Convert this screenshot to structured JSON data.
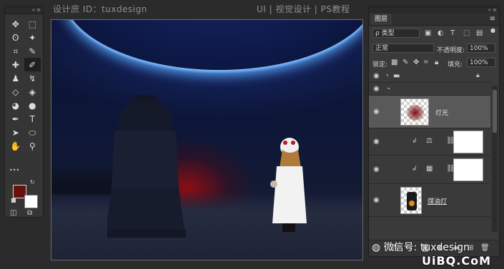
{
  "header": {
    "left_text": "设计庶 ID：tuxdesign",
    "right_text": "UI | 视觉设计 | PS教程"
  },
  "toolbar": {
    "collapse": "« ≡",
    "tools": [
      {
        "name": "move-tool",
        "glyph": "✥"
      },
      {
        "name": "marquee-tool",
        "glyph": "⬚"
      },
      {
        "name": "lasso-tool",
        "glyph": "ʘ"
      },
      {
        "name": "magic-wand-tool",
        "glyph": "✦"
      },
      {
        "name": "crop-tool",
        "glyph": "⌗"
      },
      {
        "name": "eyedropper-tool",
        "glyph": "✎"
      },
      {
        "name": "healing-tool",
        "glyph": "✚"
      },
      {
        "name": "brush-tool",
        "glyph": "✐"
      },
      {
        "name": "stamp-tool",
        "glyph": "♟"
      },
      {
        "name": "history-brush-tool",
        "glyph": "↯"
      },
      {
        "name": "eraser-tool",
        "glyph": "◇"
      },
      {
        "name": "paint-bucket-tool",
        "glyph": "◈"
      },
      {
        "name": "blur-tool",
        "glyph": "◕"
      },
      {
        "name": "dodge-tool",
        "glyph": "●"
      },
      {
        "name": "pen-tool",
        "glyph": "✒"
      },
      {
        "name": "type-tool",
        "glyph": "T"
      },
      {
        "name": "path-select-tool",
        "glyph": "➤"
      },
      {
        "name": "shape-tool",
        "glyph": "⬭"
      },
      {
        "name": "hand-tool",
        "glyph": "✋"
      },
      {
        "name": "zoom-tool",
        "glyph": "⚲"
      }
    ],
    "more": "•••",
    "foreground_color": "#6b0f0f",
    "background_color": "#ffffff"
  },
  "panel": {
    "collapse": "« ≡",
    "tab": "图层",
    "filter_label": "ρ 类型",
    "blend_mode": "正常",
    "opacity_label": "不透明度:",
    "opacity_value": "100%",
    "lock_label": "锁定:",
    "fill_label": "填充:",
    "fill_value": "100%",
    "layers": [
      {
        "name": "",
        "type": "group"
      },
      {
        "name": "",
        "type": "group-open"
      },
      {
        "name": "灯光",
        "type": "pixel"
      },
      {
        "name": "",
        "type": "adjust-balance"
      },
      {
        "name": "",
        "type": "adjust-levels"
      },
      {
        "name": "煤油灯",
        "type": "pixel"
      }
    ]
  },
  "watermark": {
    "line1": "微信号: tuxdesign",
    "line2": "UiBQ.CoM"
  }
}
